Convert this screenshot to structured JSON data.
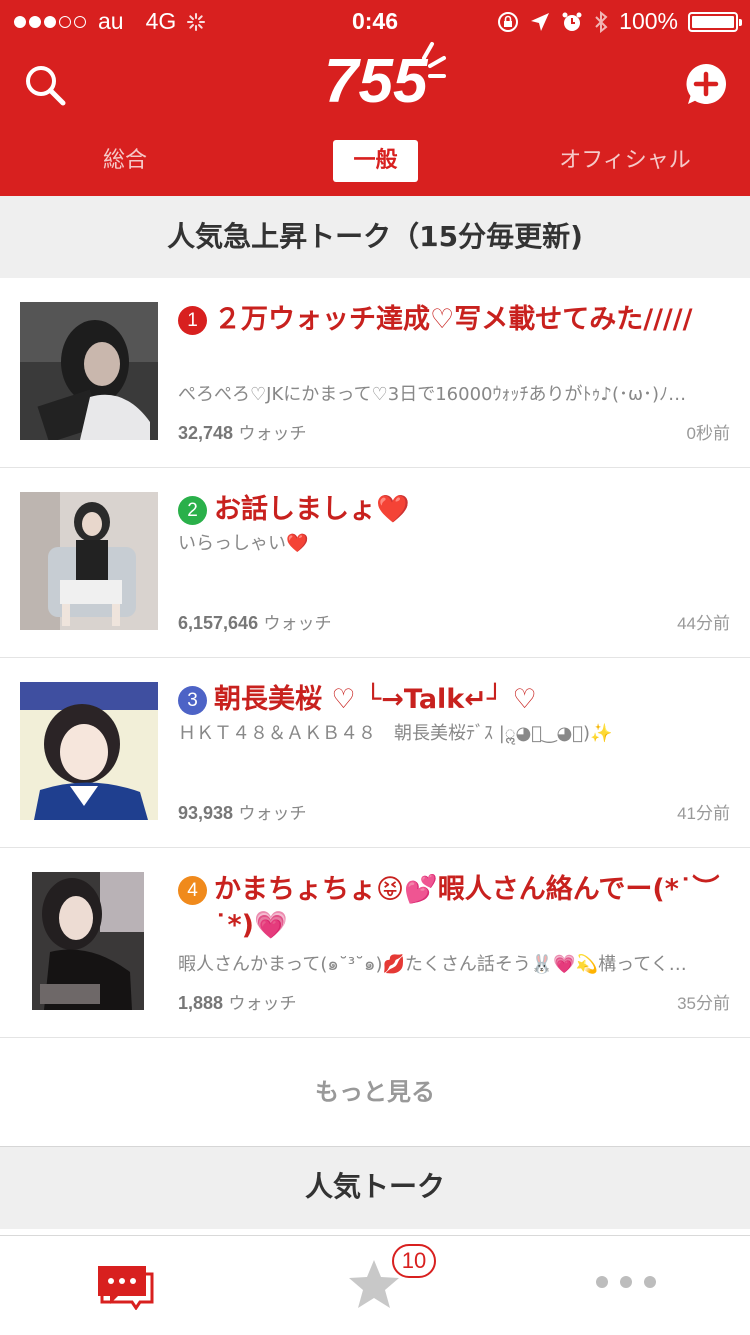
{
  "status_bar": {
    "carrier": "au",
    "network": "4G",
    "time": "0:46",
    "battery": "100%"
  },
  "header": {
    "logo_text": "755",
    "tabs": [
      {
        "label": "総合"
      },
      {
        "label": "一般",
        "active": true
      },
      {
        "label": "オフィシャル"
      }
    ]
  },
  "rising_section": {
    "title": "人気急上昇トーク（15分毎更新)"
  },
  "items": [
    {
      "rank": "1",
      "rank_color": "#d8201f",
      "title": "２万ウォッチ達成♡写メ載せてみた/////",
      "description": "ぺろぺろ♡JKにかまって♡3日で16000ｳｫｯﾁありがﾄｩ♪(･ω･)ﾉ…",
      "watch_count": "32,748",
      "watch_label": "ウォッチ",
      "time": "0秒前"
    },
    {
      "rank": "2",
      "rank_color": "#2ab04a",
      "title": "お話しましょ❤️",
      "description": "いらっしゃい❤️",
      "watch_count": "6,157,646",
      "watch_label": "ウォッチ",
      "time": "44分前"
    },
    {
      "rank": "3",
      "rank_color": "#4d63c6",
      "title": "朝長美桜 ♡ └→Talk↵┘ ♡",
      "description": "ＨＫＴ４８＆ＡＫＢ４８　朝長美桜ﾃﾞｽ |ॢ◕ि‿◕ि)✨",
      "watch_count": "93,938",
      "watch_label": "ウォッチ",
      "time": "41分前"
    },
    {
      "rank": "4",
      "rank_color": "#f08a1c",
      "title": "かまちょちょ😝💕暇人さん絡んでー(*˙︶˙*)💗",
      "description": "暇人さんかまって(๑˘³˘๑)💋たくさん話そう🐰💗💫構ってく…",
      "watch_count": "1,888",
      "watch_label": "ウォッチ",
      "time": "35分前"
    }
  ],
  "more_label": "もっと見る",
  "popular_section": {
    "title": "人気トーク"
  },
  "tab_bar": {
    "star_badge": "10"
  },
  "colors": {
    "brand_red": "#d8201f",
    "title_red": "#c8211e"
  }
}
